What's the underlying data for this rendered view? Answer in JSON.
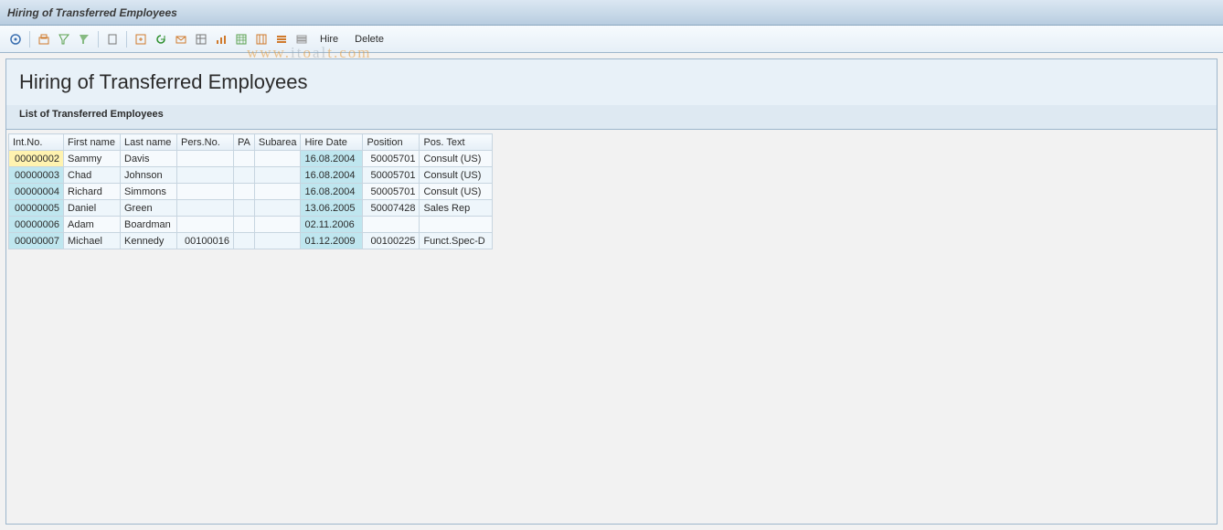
{
  "window": {
    "title": "Hiring of Transferred Employees"
  },
  "toolbar": {
    "hire_label": "Hire",
    "delete_label": "Delete",
    "icons": [
      "details-icon",
      "print-preview-icon",
      "find-icon",
      "filter-icon",
      "page-icon",
      "export-icon",
      "refresh-icon",
      "send-icon",
      "layout-icon",
      "chart-icon",
      "spreadsheet-icon",
      "abc-icon",
      "select-all-icon",
      "deselect-all-icon"
    ]
  },
  "panel": {
    "heading": "Hiring of Transferred Employees",
    "subheading": "List of Transferred Employees"
  },
  "table": {
    "columns": [
      {
        "key": "int_no",
        "label": "Int.No."
      },
      {
        "key": "first_name",
        "label": "First name"
      },
      {
        "key": "last_name",
        "label": "Last name"
      },
      {
        "key": "pers_no",
        "label": "Pers.No."
      },
      {
        "key": "pa",
        "label": "PA"
      },
      {
        "key": "subarea",
        "label": "Subarea"
      },
      {
        "key": "hire_date",
        "label": "Hire Date"
      },
      {
        "key": "position",
        "label": "Position"
      },
      {
        "key": "pos_text",
        "label": "Pos. Text"
      }
    ],
    "rows": [
      {
        "int_no": "00000002",
        "first_name": "Sammy",
        "last_name": "Davis",
        "pers_no": "",
        "pa": "",
        "subarea": "",
        "hire_date": "16.08.2004",
        "position": "50005701",
        "pos_text": "Consult (US)"
      },
      {
        "int_no": "00000003",
        "first_name": "Chad",
        "last_name": "Johnson",
        "pers_no": "",
        "pa": "",
        "subarea": "",
        "hire_date": "16.08.2004",
        "position": "50005701",
        "pos_text": "Consult (US)"
      },
      {
        "int_no": "00000004",
        "first_name": "Richard",
        "last_name": "Simmons",
        "pers_no": "",
        "pa": "",
        "subarea": "",
        "hire_date": "16.08.2004",
        "position": "50005701",
        "pos_text": "Consult (US)"
      },
      {
        "int_no": "00000005",
        "first_name": "Daniel",
        "last_name": "Green",
        "pers_no": "",
        "pa": "",
        "subarea": "",
        "hire_date": "13.06.2005",
        "position": "50007428",
        "pos_text": "Sales Rep"
      },
      {
        "int_no": "00000006",
        "first_name": "Adam",
        "last_name": "Boardman",
        "pers_no": "",
        "pa": "",
        "subarea": "",
        "hire_date": "02.11.2006",
        "position": "",
        "pos_text": ""
      },
      {
        "int_no": "00000007",
        "first_name": "Michael",
        "last_name": "Kennedy",
        "pers_no": "00100016",
        "pa": "",
        "subarea": "",
        "hire_date": "01.12.2009",
        "position": "00100225",
        "pos_text": "Funct.Spec-D"
      }
    ]
  },
  "watermark": {
    "text_orange": "www.",
    "text_gray_1": "it",
    "text_orange_2": "o",
    "text_gray_2": "al",
    "text_orange_3": "t.com"
  }
}
